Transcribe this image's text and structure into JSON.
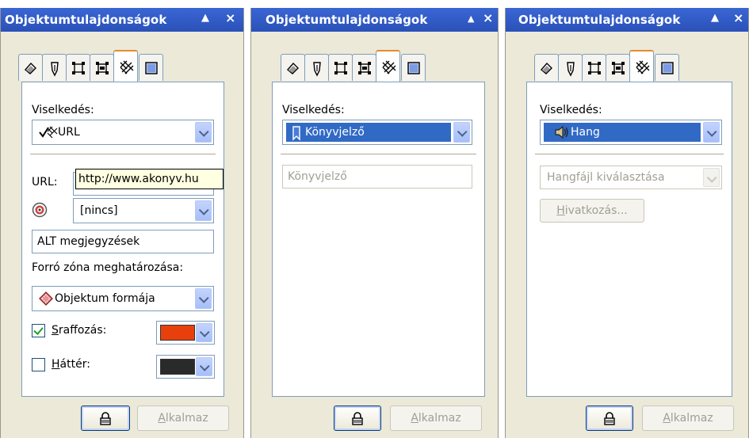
{
  "panels": [
    {
      "title": "Objektumtulajdonságok",
      "minimize_glyph": "▲",
      "close_glyph": "×",
      "behavior_label": "Viselkedés:",
      "behavior_value": "URL",
      "url_label": "URL:",
      "url_value": "http://www.akonyv.hu",
      "target_value": "[nincs]",
      "alt_value": "ALT megjegyzések",
      "hotspot_label": "Forró zóna meghatározása:",
      "hotspot_value": "Objektum formája",
      "hatch_label": "Sraffozás:",
      "hatch_checked": true,
      "hatch_color": "#e8400c",
      "background_label": "Háttér:",
      "background_checked": false,
      "background_color": "#2a2a2a",
      "apply_label": "Alkalmaz"
    },
    {
      "title": "Objektumtulajdonságok",
      "minimize_glyph": "▲",
      "close_glyph": "×",
      "behavior_label": "Viselkedés:",
      "behavior_value": "Könyvjelző",
      "bookmark_field": "Könyvjelző",
      "apply_label": "Alkalmaz"
    },
    {
      "title": "Objektumtulajdonságok",
      "minimize_glyph": "▲",
      "close_glyph": "×",
      "behavior_label": "Viselkedés:",
      "behavior_value": "Hang",
      "sound_select": "Hangfájl kiválasztása",
      "link_button": "Hivatkozás...",
      "apply_label": "Alkalmaz"
    }
  ],
  "tabs": [
    "fill-icon",
    "outline-icon",
    "general-icon",
    "detail-icon",
    "internet-icon",
    "summary-icon"
  ],
  "colors": {
    "titlebar": "#2b54bf",
    "panel_bg": "#ece9d8",
    "selection": "#316ac5",
    "active_tab": "#e68b2c"
  }
}
